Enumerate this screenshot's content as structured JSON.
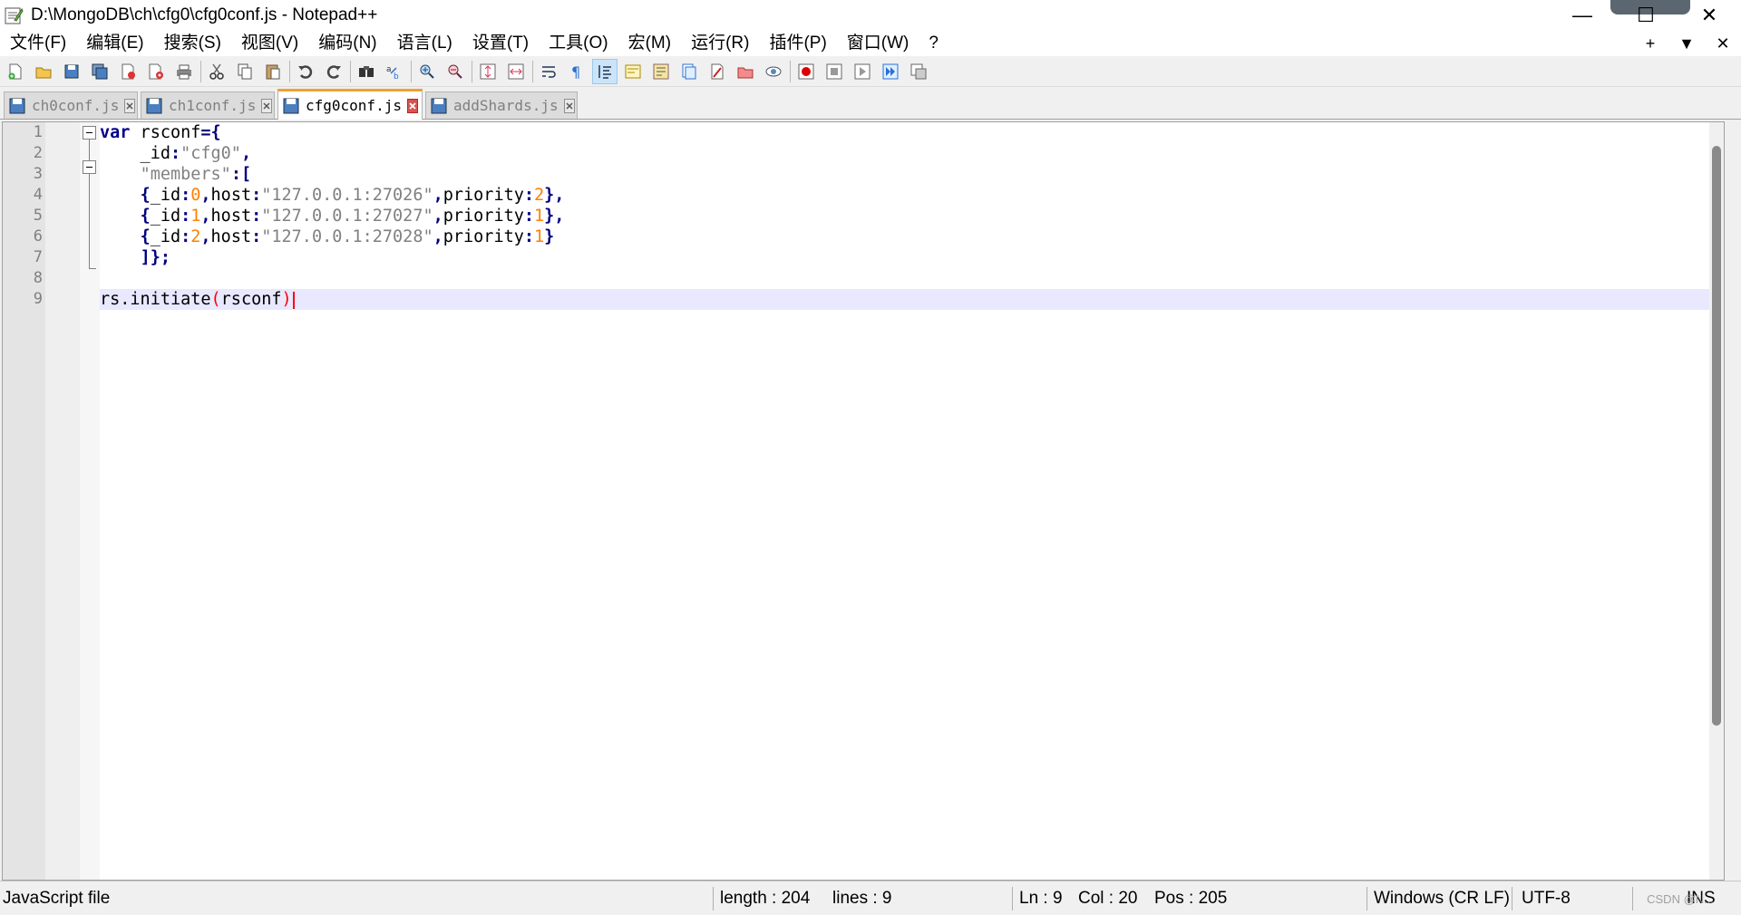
{
  "window": {
    "title": "D:\\MongoDB\\ch\\cfg0\\cfg0conf.js - Notepad++",
    "minimize": "—",
    "maximize": "☐",
    "close": "✕"
  },
  "menu": {
    "items": [
      "文件(F)",
      "编辑(E)",
      "搜索(S)",
      "视图(V)",
      "编码(N)",
      "语言(L)",
      "设置(T)",
      "工具(O)",
      "宏(M)",
      "运行(R)",
      "插件(P)",
      "窗口(W)",
      "?"
    ],
    "right": [
      "+",
      "▼",
      "✕"
    ]
  },
  "toolbar": {
    "buttons": [
      "new-file",
      "open-file",
      "save",
      "save-all",
      "close",
      "close-all",
      "print",
      "cut",
      "copy",
      "paste",
      "undo",
      "redo",
      "find",
      "replace",
      "zoom-in",
      "zoom-out",
      "sync-vertical",
      "sync-horizontal",
      "word-wrap",
      "show-all-chars",
      "indent-guide",
      "user-defined-language",
      "document-map",
      "function-list",
      "doc-panel",
      "folder-as-workspace",
      "monitoring",
      "record-macro",
      "stop-macro",
      "play-macro",
      "run-macro-multiple",
      "save-macro"
    ]
  },
  "tabs": [
    {
      "label": "ch0conf.js",
      "active": false
    },
    {
      "label": "ch1conf.js",
      "active": false
    },
    {
      "label": "cfg0conf.js",
      "active": true
    },
    {
      "label": "addShards.js",
      "active": false
    }
  ],
  "editor": {
    "line_numbers": [
      "1",
      "2",
      "3",
      "4",
      "5",
      "6",
      "7",
      "8",
      "9"
    ],
    "lines": [
      "var rsconf={",
      "    _id:\"cfg0\",",
      "    \"members\":[",
      "    {_id:0,host:\"127.0.0.1:27026\",priority:2},",
      "    {_id:1,host:\"127.0.0.1:27027\",priority:1},",
      "    {_id:2,host:\"127.0.0.1:27028\",priority:1}",
      "    ]};",
      "",
      "rs.initiate(rsconf)"
    ],
    "current_line": 9
  },
  "status": {
    "language": "JavaScript file",
    "length": "length : 204",
    "lines": "lines : 9",
    "ln": "Ln : 9",
    "col": "Col : 20",
    "pos": "Pos : 205",
    "eol": "Windows (CR LF)",
    "encoding": "UTF-8",
    "mode": "INS",
    "watermark": "CSDN @N..."
  },
  "colors": {
    "keyword": "#00008b",
    "string": "#808080",
    "number": "#ff8000",
    "operator": "#000080",
    "current_line": "#e8e8ff",
    "tab_accent": "#f0a030"
  }
}
